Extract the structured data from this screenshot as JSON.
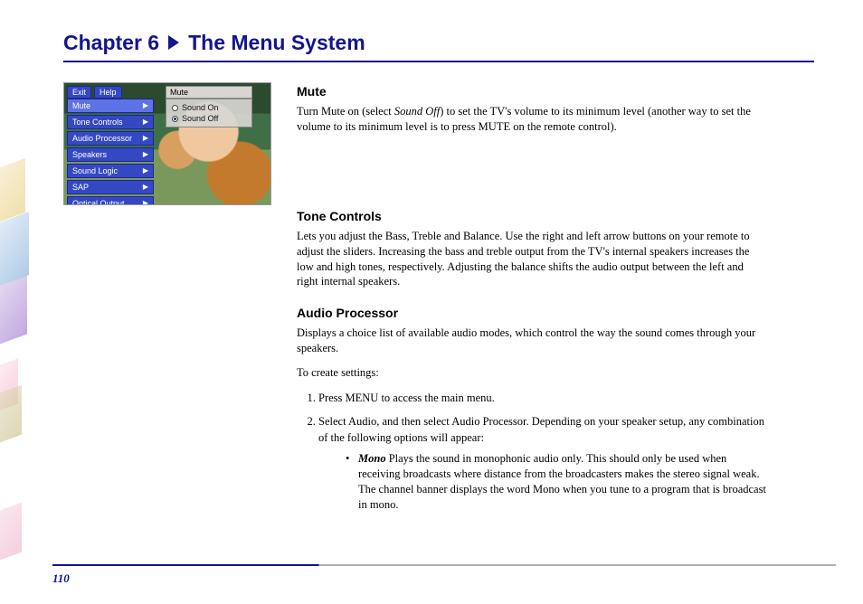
{
  "header": {
    "chapter": "Chapter 6",
    "title": "The Menu System"
  },
  "screenshot": {
    "topbar": [
      "Exit",
      "Help"
    ],
    "panel": {
      "title": "Mute",
      "options": [
        "Sound On",
        "Sound Off"
      ]
    },
    "menu": [
      "Mute",
      "Tone Controls",
      "Audio Processor",
      "Speakers",
      "Sound Logic",
      "SAP",
      "Optical Output"
    ]
  },
  "sections": {
    "mute": {
      "heading": "Mute",
      "p1a": "Turn Mute on (select ",
      "em": "Sound Off",
      "p1b": ") to set the TV's volume to its minimum level (another way to set the volume to its minimum level is to press MUTE on the remote control)."
    },
    "tone": {
      "heading": "Tone Controls",
      "p1": "Lets you adjust the Bass, Treble and Balance. Use the right and left arrow buttons on your remote to adjust the sliders. Increasing the bass and treble output from the TV's internal speakers increases the low and high tones, respectively. Adjusting the balance shifts the audio output between the left and right internal speakers."
    },
    "audio": {
      "heading": "Audio Processor",
      "p1": "Displays a choice list of available audio modes, which control the way the sound comes through your speakers.",
      "p2": "To create settings:",
      "steps": [
        "Press MENU to access the main menu."
      ],
      "step2": {
        "a": "Select ",
        "em1": "Audio",
        "b": ", and then select ",
        "em2": "Audio Processor",
        "c": ". Depending on your speaker setup, any combination of the following options will appear:"
      },
      "mono": {
        "label": "Mono",
        "text": "  Plays the sound in monophonic audio only. This should only be used when receiving broadcasts where distance from the broadcasters makes the stereo signal weak. The channel banner displays the word Mono when you tune to a program that is broadcast in mono."
      }
    }
  },
  "footer": {
    "page": "110"
  }
}
